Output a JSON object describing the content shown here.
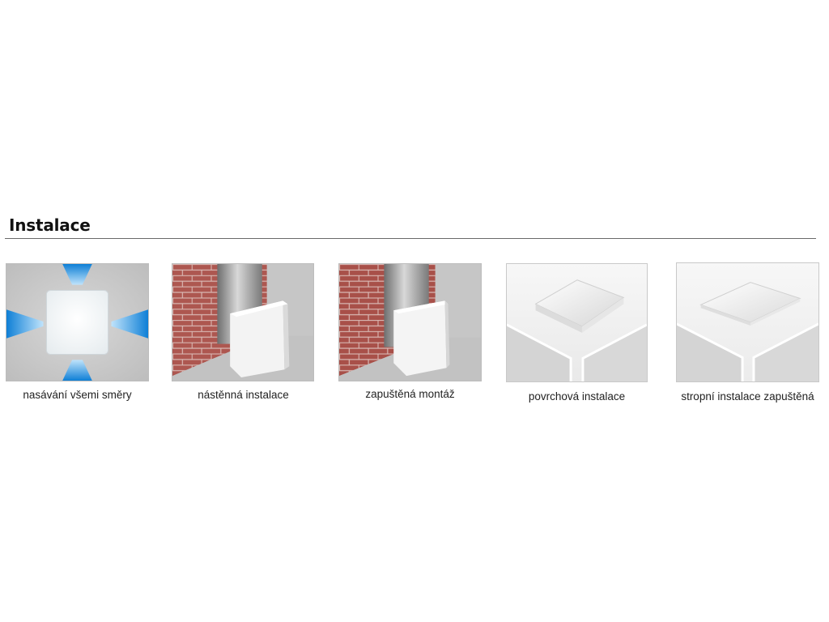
{
  "section": {
    "title": "Instalace"
  },
  "items": [
    {
      "caption": "nasávání všemi směry",
      "icon": "omnidirectional-intake-icon"
    },
    {
      "caption": "nástěnná instalace",
      "icon": "wall-installation-icon"
    },
    {
      "caption": "zapuštěná montáž",
      "icon": "recessed-mounting-icon"
    },
    {
      "caption": "povrchová instalace",
      "icon": "surface-installation-icon"
    },
    {
      "caption": "stropní instalace zapuštěná",
      "icon": "recessed-ceiling-installation-icon"
    }
  ],
  "colors": {
    "arrow": "#1e8fe0",
    "brick": "#a8514a",
    "wall": "#c9c9c9",
    "panel": "#f4f4f4"
  }
}
